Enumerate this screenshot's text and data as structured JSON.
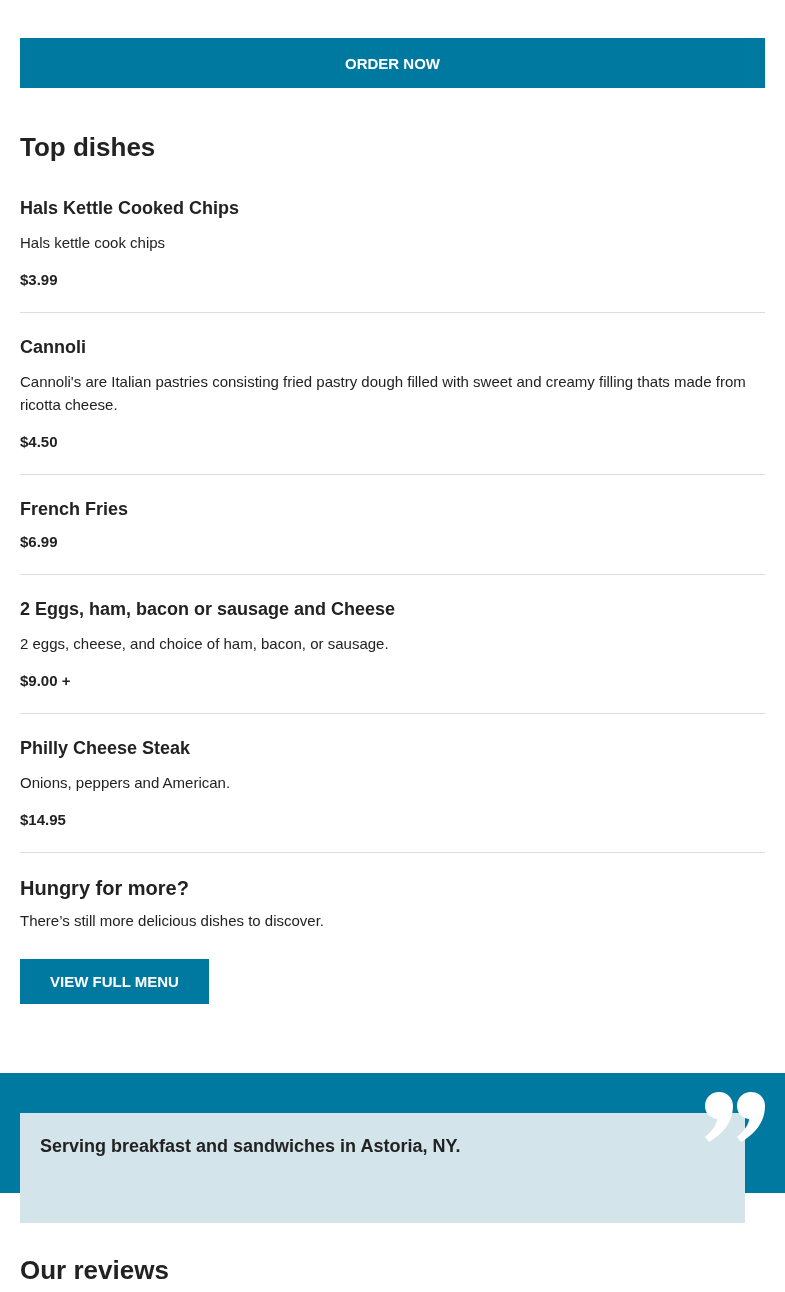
{
  "order_button": {
    "label": "ORDER NOW"
  },
  "top_dishes": {
    "title": "Top dishes",
    "dishes": [
      {
        "name": "Hals Kettle Cooked Chips",
        "description": "Hals kettle cook chips",
        "price": "$3.99"
      },
      {
        "name": "Cannoli",
        "description": "Cannoli's are Italian pastries consisting fried pastry dough filled with sweet and creamy filling thats made from ricotta cheese.",
        "price": "$4.50"
      },
      {
        "name": "French Fries",
        "price": "$6.99"
      },
      {
        "name": "2 Eggs, ham, bacon or sausage and Cheese",
        "description": "2 eggs, cheese, and choice of ham, bacon, or sausage.",
        "price": "$9.00 +"
      },
      {
        "name": "Philly Cheese Steak",
        "description": "Onions, peppers and American.",
        "price": "$14.95"
      }
    ]
  },
  "more": {
    "title": "Hungry for more?",
    "text": "There’s still more delicious dishes to discover.",
    "button": "VIEW FULL MENU"
  },
  "quote": {
    "text": "Serving breakfast and sandwiches in Astoria, NY."
  },
  "reviews": {
    "title": "Our reviews"
  }
}
